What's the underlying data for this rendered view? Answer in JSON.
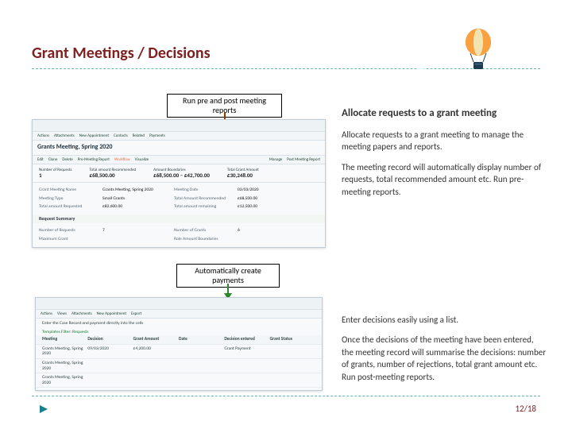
{
  "page": {
    "title": "Grant Meetings / Decisions",
    "footer_page": "12/18"
  },
  "callouts": {
    "top": "Run pre and post meeting reports",
    "mid": "Automatically create payments"
  },
  "right": {
    "heading": "Allocate requests to a grant meeting",
    "p1": "Allocate requests to a grant meeting to manage the meeting papers and reports.",
    "p2": "The meeting record will automatically display number of requests, total recommended amount etc. Run pre-meeting reports.",
    "p3": "Enter decisions easily using a list.",
    "p4": "Once the decisions of the meeting have been entered, the meeting record will summarise the decisions: number of grants, number of rejections, total grant amount etc. Run post-meeting reports."
  },
  "shot1": {
    "toolbar_items": [
      "Actions",
      "Attachments",
      "New Appointment",
      "Contacts",
      "Related",
      "Payments"
    ],
    "work_items_left": [
      "Edit",
      "Clone",
      "Delete",
      "Pre-Meeting Report",
      "Workflow",
      "Visualize"
    ],
    "work_items_right": [
      "Manage",
      "Post Meeting Report"
    ],
    "header": "Grants Meeting, Spring 2020",
    "summary_labels": [
      "Number of Requests",
      "Total amount Recommended",
      "Amount Boundaries",
      "Total Grant Amount"
    ],
    "summary_values": [
      "1",
      "£68,500.00",
      "£68,500.00 – £42,700.00",
      "£30,248.00"
    ],
    "fields": {
      "grant_meeting_name_lbl": "Grant Meeting Name",
      "grant_meeting_name_val": "Grants Meeting, Spring 2020",
      "meeting_date_lbl": "Meeting Date",
      "meeting_date_val": "03/03/2020",
      "meeting_type_lbl": "Meeting Type",
      "meeting_type_val": "Small Grants",
      "total_rec_lbl": "Total Amount Recommended",
      "total_rec_val": "£68,500.00",
      "total_req_lbl": "Total amount Requested",
      "total_req_val": "£82,600.00",
      "total_rem_lbl": "Total amount remaining",
      "total_rem_val": "£12,500.00",
      "section_label": "Request Summary",
      "num_requests_lbl": "Number of Requests",
      "num_requests_val": "7",
      "num_grants_lbl": "Number of Grants",
      "num_grants_val": "6",
      "max_grant_lbl": "Maximum Grant",
      "max_grant_val": "",
      "role_bdry_lbl": "Role Amount Boundaries",
      "role_bdry_val": ""
    }
  },
  "shot2": {
    "toolbar_items": [
      "Actions",
      "Views",
      "Attachments",
      "New Appointment",
      "Export"
    ],
    "subtitle": "Enter the Case Record and payment directly into the cells",
    "filter": "Templates Filter: Requests",
    "cols": [
      "Meeting",
      "Decision",
      "Grant Amount",
      "Date",
      "Decision entered",
      "Grant Status"
    ],
    "row1": [
      "Grants Meeting, Spring 2020",
      "09/03/2020",
      "£4,200.00",
      "",
      "Grant Payment",
      ""
    ],
    "row2": [
      "Grants Meeting, Spring 2020",
      "",
      "",
      "",
      "",
      ""
    ],
    "row3": [
      "Grants Meeting, Spring 2020",
      "",
      "",
      "",
      "",
      ""
    ]
  },
  "icons": {
    "footer_mark": "footer-accent-icon"
  }
}
